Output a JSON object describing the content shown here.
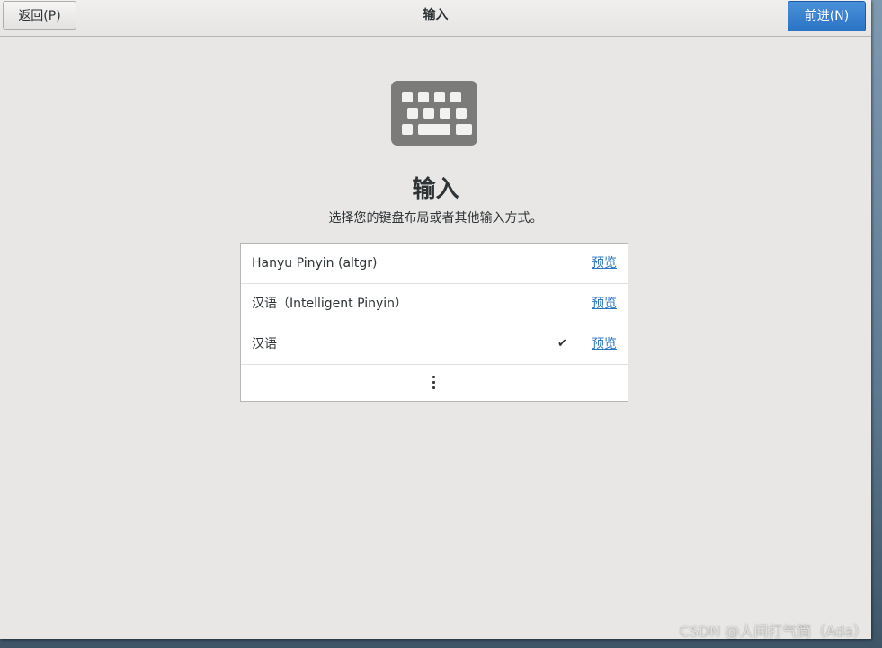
{
  "header": {
    "back_label": "返回(P)",
    "title": "输入",
    "next_label": "前进(N)"
  },
  "main": {
    "icon": "keyboard-icon",
    "heading": "输入",
    "subheading": "选择您的键盘布局或者其他输入方式。",
    "sources": [
      {
        "label": "Hanyu Pinyin (altgr)",
        "selected": false,
        "preview_label": "预览"
      },
      {
        "label": "汉语（Intelligent Pinyin）",
        "selected": false,
        "preview_label": "预览"
      },
      {
        "label": "汉语",
        "selected": true,
        "check": "✔",
        "preview_label": "预览"
      }
    ],
    "more_icon": "more-vertical-icon"
  },
  "watermark": "CSDN @人间打气筒（Ada）",
  "colors": {
    "accent": "#2b74c6",
    "link": "#2a76c6",
    "background": "#e8e7e5"
  }
}
